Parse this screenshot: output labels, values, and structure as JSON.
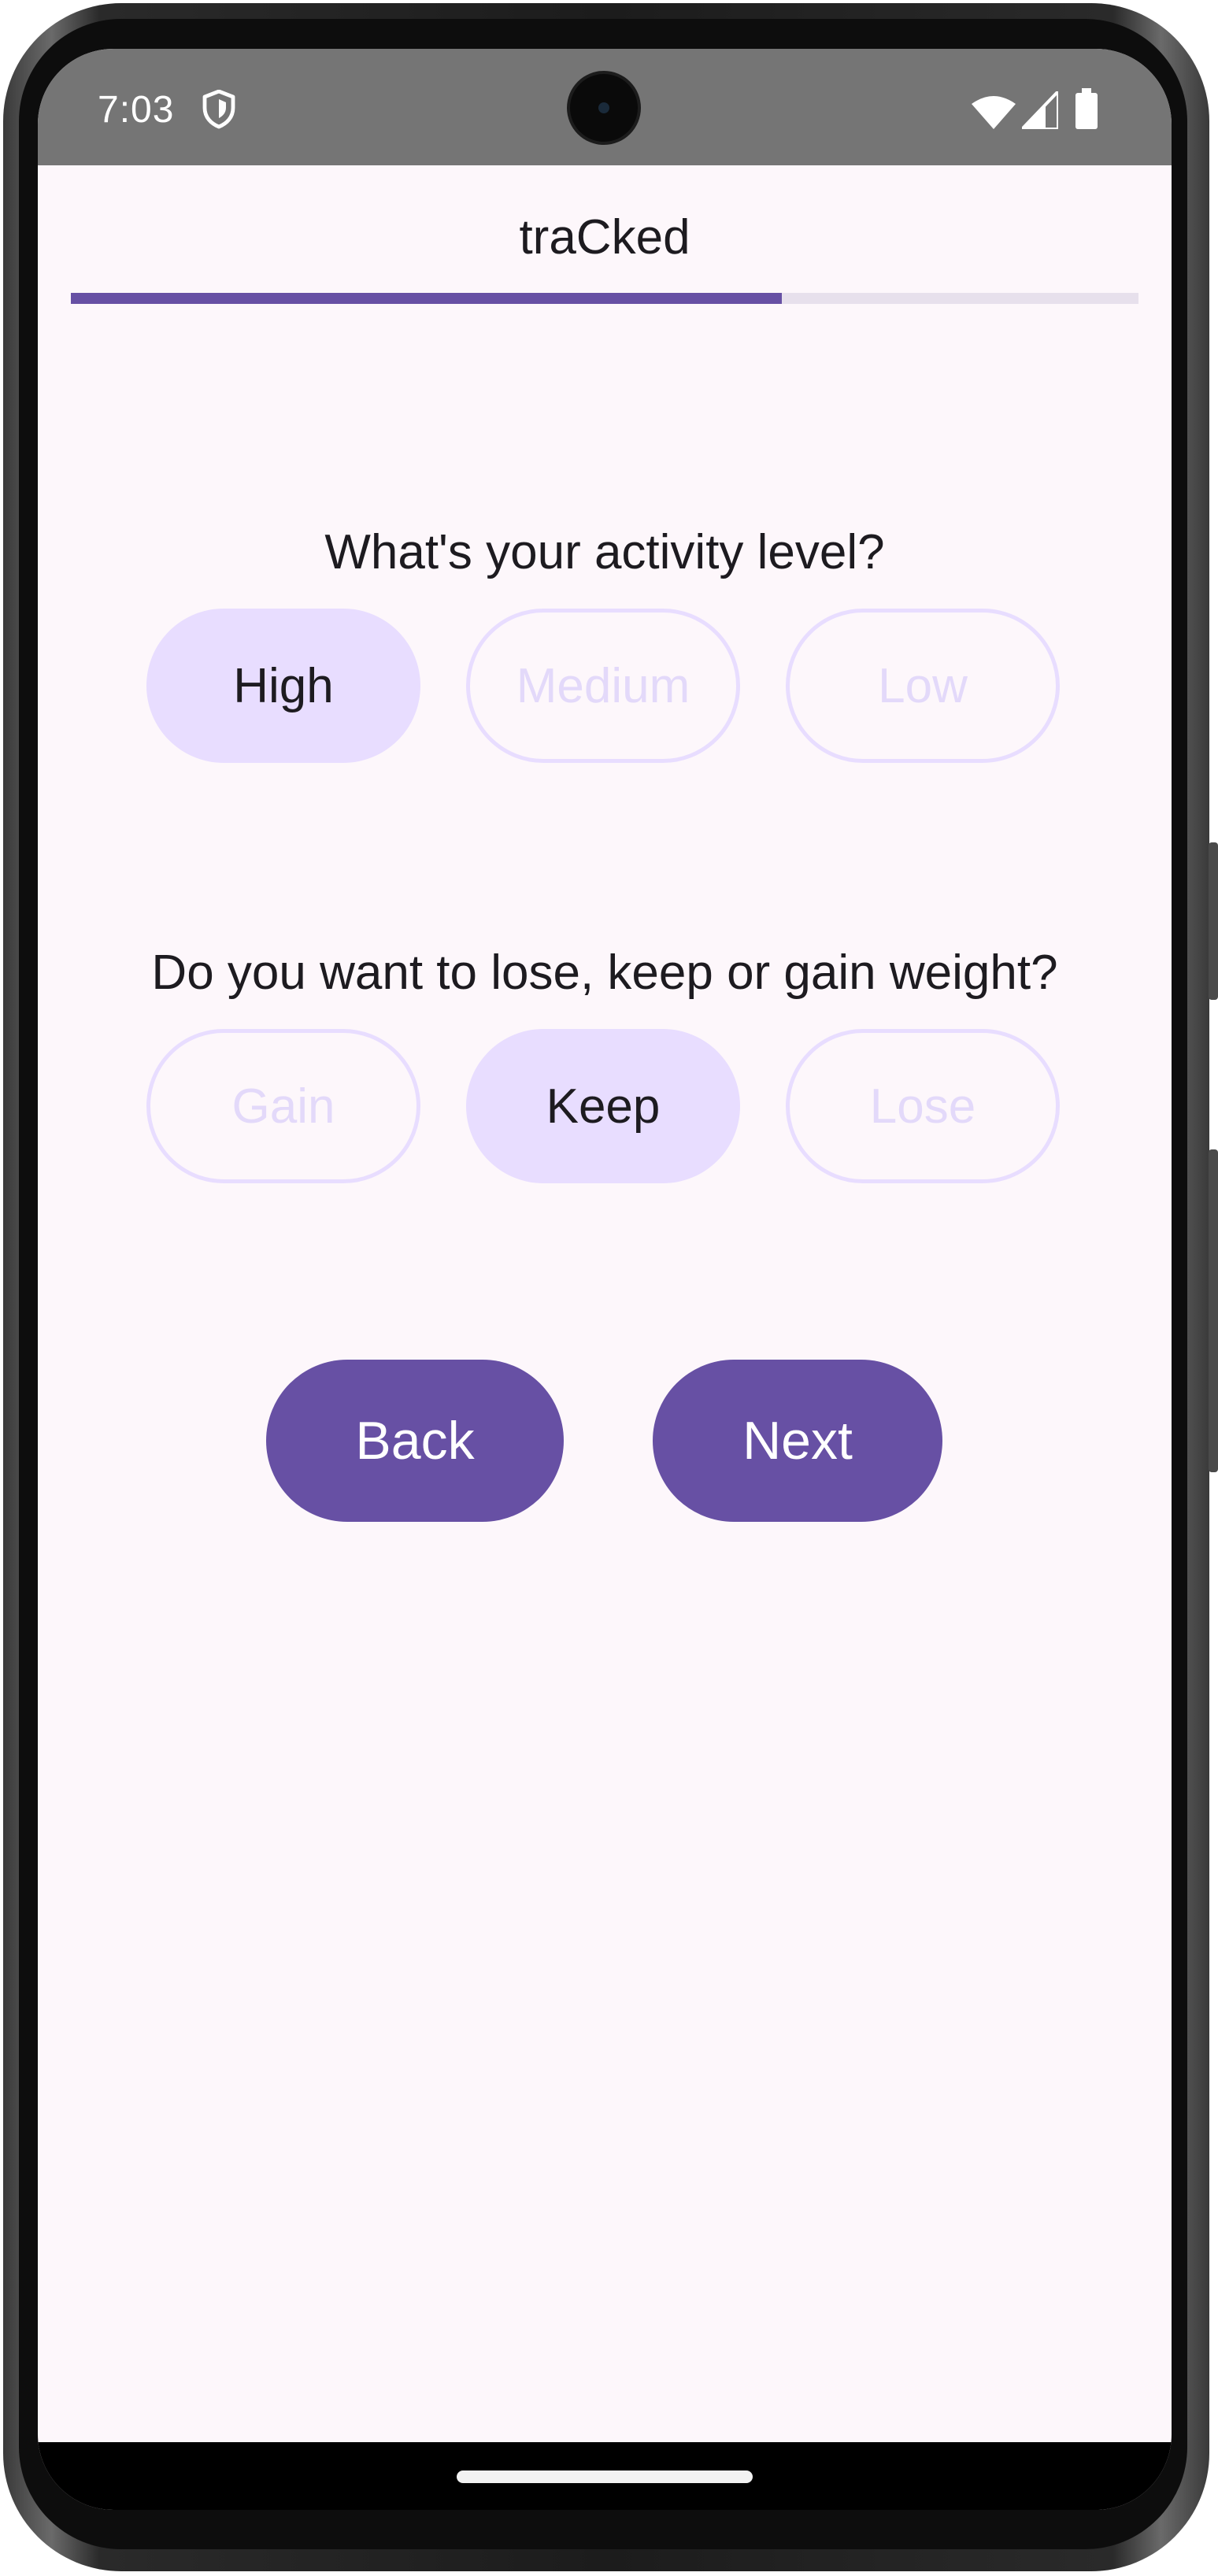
{
  "status_bar": {
    "time": "7:03",
    "icons": [
      "shield-icon",
      "wifi-icon",
      "signal-icon",
      "battery-icon"
    ]
  },
  "app": {
    "title": "traCked"
  },
  "progress": {
    "fraction": 0.666
  },
  "activity": {
    "question": "What's your activity level?",
    "options": [
      "High",
      "Medium",
      "Low"
    ],
    "selected": "High"
  },
  "goal": {
    "question": "Do you want to lose, keep or gain weight?",
    "options": [
      "Gain",
      "Keep",
      "Lose"
    ],
    "selected": "Keep"
  },
  "buttons": {
    "back": "Back",
    "next": "Next"
  },
  "colors": {
    "primary": "#6750a4",
    "selected_chip": "#e8ddff",
    "unselected_chip_text": "#e3d9fa",
    "background": "#fdf7fb",
    "status_bar": "#757575"
  }
}
